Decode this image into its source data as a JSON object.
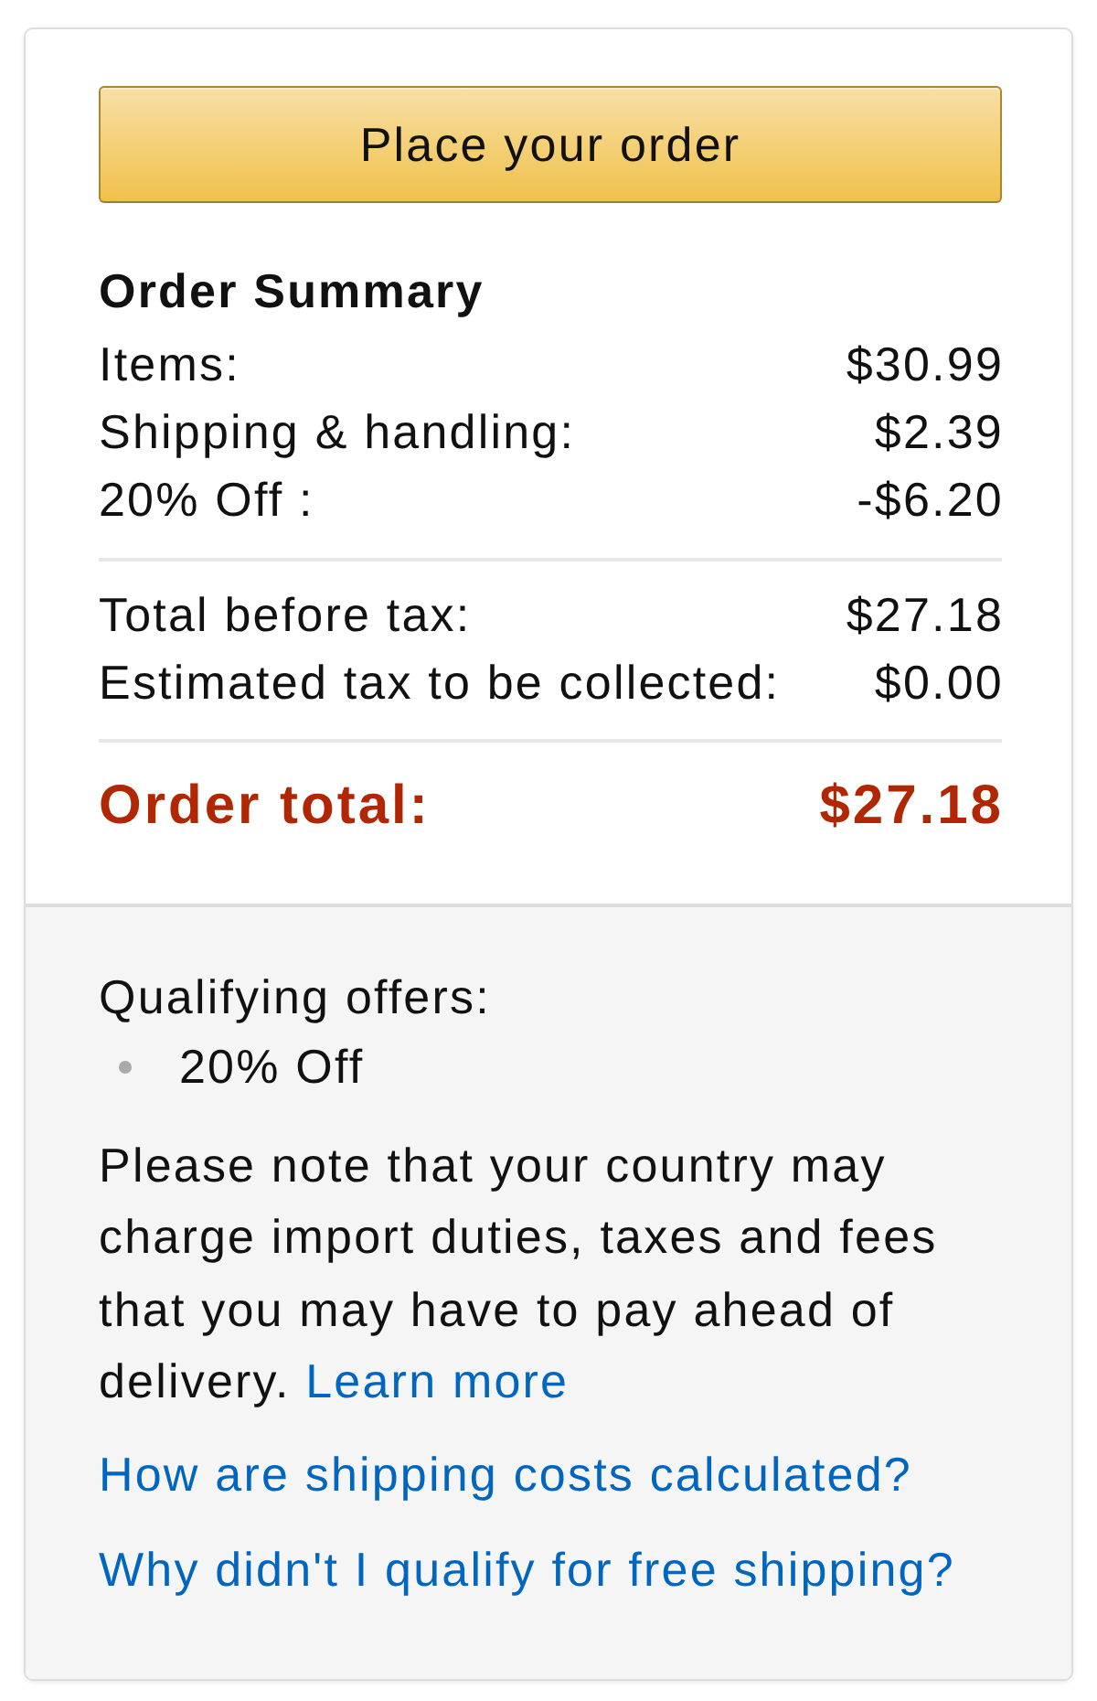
{
  "button": {
    "label": "Place your order"
  },
  "order_summary": {
    "title": "Order Summary",
    "lines": [
      {
        "label": "Items:",
        "value": "$30.99"
      },
      {
        "label": "Shipping & handling:",
        "value": "$2.39"
      },
      {
        "label": "20% Off :",
        "value": "-$6.20"
      }
    ],
    "subtotals": [
      {
        "label": "Total before tax:",
        "value": "$27.18"
      },
      {
        "label": "Estimated tax to be collected:",
        "value": "$0.00"
      }
    ],
    "total": {
      "label": "Order total:",
      "value": "$27.18"
    }
  },
  "offers": {
    "title": "Qualifying offers:",
    "items": [
      "20% Off"
    ]
  },
  "note": {
    "text": "Please note that your country may charge import duties, taxes and fees that you may have to pay ahead of delivery.",
    "link": "Learn more"
  },
  "links": [
    "How are shipping costs calculated?",
    "Why didn't I qualify for free shipping?"
  ]
}
